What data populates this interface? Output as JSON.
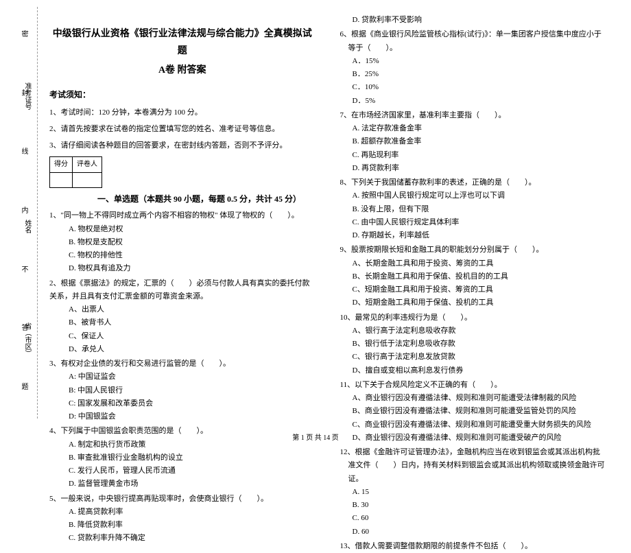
{
  "binding": {
    "markers": [
      "密",
      "封",
      "线",
      "内",
      "不",
      "答",
      "题"
    ],
    "labels": {
      "province": "省（市区）",
      "name": "姓名",
      "ticket": "准考证号"
    }
  },
  "header": {
    "title": "中级银行从业资格《银行业法律法规与综合能力》全真模拟试题",
    "subtitle": "A卷 附答案"
  },
  "notice": {
    "heading": "考试须知：",
    "items": [
      "1、考试时间：120 分钟，本卷满分为 100 分。",
      "2、请首先按要求在试卷的指定位置填写您的姓名、准考证号等信息。",
      "3、请仔细阅读各种题目的回答要求，在密封线内答题，否则不予评分。"
    ]
  },
  "score_table": {
    "c1": "得分",
    "c2": "评卷人"
  },
  "section1": "一、单选题（本题共 90 小题，每题 0.5 分，共计 45 分）",
  "left_questions": [
    {
      "stem": "1、\"同一物上不得同时成立两个内容不相容的物权\" 体现了物权的（　　）。",
      "opts": [
        "A. 物权是绝对权",
        "B. 物权是支配权",
        "C. 物权的排他性",
        "D. 物权具有追及力"
      ]
    },
    {
      "stem": "2、根据《票据法》的规定，汇票的（　　）必须与付款人具有真实的委托付款关系，并且具有支付汇票金额的可靠资金来源。",
      "opts": [
        "A、出票人",
        "B、被背书人",
        "C、保证人",
        "D、承兑人"
      ]
    },
    {
      "stem": "3、有权对企业债的发行和交易进行监管的是（　　）。",
      "opts": [
        "A: 中国证监会",
        "B: 中国人民银行",
        "C: 国家发展和改革委员会",
        "D: 中国银监会"
      ]
    },
    {
      "stem": "4、下列属于中国银监会职责范围的是（　　）。",
      "opts": [
        "A. 制定和执行货币政策",
        "B. 审查批准银行业金融机构的设立",
        "C. 发行人民币，管理人民币流通",
        "D. 监督管理黄金市场"
      ]
    },
    {
      "stem": "5、一般来说，中央银行提高再贴现率时，会使商业银行（　　）。",
      "opts": [
        "A. 提高贷款利率",
        "B. 降低贷款利率",
        "C. 贷款利率升降不确定"
      ]
    }
  ],
  "right_items": [
    {
      "type": "opt",
      "text": "D. 贷款利率不受影响"
    },
    {
      "type": "stem",
      "text": "6、根据《商业银行风险监管核心指标(试行)》：单一集团客户授信集中度应小于等于（　　）。"
    },
    {
      "type": "opt",
      "text": "A．15%"
    },
    {
      "type": "opt",
      "text": "B．25%"
    },
    {
      "type": "opt",
      "text": "C．10%"
    },
    {
      "type": "opt",
      "text": "D．5%"
    },
    {
      "type": "stem",
      "text": "7、在市场经济国家里，基准利率主要指（　　）。"
    },
    {
      "type": "opt",
      "text": "A. 法定存款准备金率"
    },
    {
      "type": "opt",
      "text": "B. 超额存款准备金率"
    },
    {
      "type": "opt",
      "text": "C. 再贴现利率"
    },
    {
      "type": "opt",
      "text": "D. 再贷款利率"
    },
    {
      "type": "stem",
      "text": "8、下列关于我国储蓄存款利率的表述，正确的是（　　）。"
    },
    {
      "type": "opt",
      "text": "A. 按照中国人民银行规定可以上浮也可以下调"
    },
    {
      "type": "opt",
      "text": "B. 没有上限，但有下限"
    },
    {
      "type": "opt",
      "text": "C. 由中国人民银行规定具体利率"
    },
    {
      "type": "opt",
      "text": "D. 存期越长，利率越低"
    },
    {
      "type": "stem",
      "text": "9、股票按期限长短和金融工具的职能划分分别属于（　　）。"
    },
    {
      "type": "opt",
      "text": "A、长期金融工具和用于投资、筹资的工具"
    },
    {
      "type": "opt",
      "text": "B、长期金融工具和用于保值、投机目的的工具"
    },
    {
      "type": "opt",
      "text": "C、短期金融工具和用于投资、筹资的工具"
    },
    {
      "type": "opt",
      "text": "D、短期金融工具和用于保值、投机的工具"
    },
    {
      "type": "stem",
      "text": "10、最常见的利率违规行为是（　　）。"
    },
    {
      "type": "opt",
      "text": "A、银行高于法定利息吸收存款"
    },
    {
      "type": "opt",
      "text": "B、银行低于法定利息吸收存款"
    },
    {
      "type": "opt",
      "text": "C、银行高于法定利息发放贷款"
    },
    {
      "type": "opt",
      "text": "D、擅自或变相以高利息发行债券"
    },
    {
      "type": "stem",
      "text": "11、以下关于合规风险定义不正确的有（　　）。"
    },
    {
      "type": "opt",
      "text": "A、商业银行因没有遵循法律、规则和准则可能遭受法律制裁的风险"
    },
    {
      "type": "opt",
      "text": "B、商业银行因没有遵循法律、规则和准则可能遭受监管处罚的风险"
    },
    {
      "type": "opt",
      "text": "C、商业银行因没有遵循法律、规则和准则可能遭受重大财务损失的风险"
    },
    {
      "type": "opt",
      "text": "D、商业银行因没有遵循法律、规则和准则可能遭受破产的风险"
    },
    {
      "type": "stem",
      "text": "12、根据《金融许可证管理办法》，金融机构应当在收到银监会或其派出机构批准文件（　　）日内，持有关材料到银监会或其派出机构领取或换领金融许可证。"
    },
    {
      "type": "opt",
      "text": "A. 15"
    },
    {
      "type": "opt",
      "text": "B. 30"
    },
    {
      "type": "opt",
      "text": "C. 60"
    },
    {
      "type": "opt",
      "text": "D. 60"
    },
    {
      "type": "stem",
      "text": "13、借款人需要调整借款期限的前提条件不包括（　　）。"
    }
  ],
  "footer": "第 1 页 共 14 页"
}
